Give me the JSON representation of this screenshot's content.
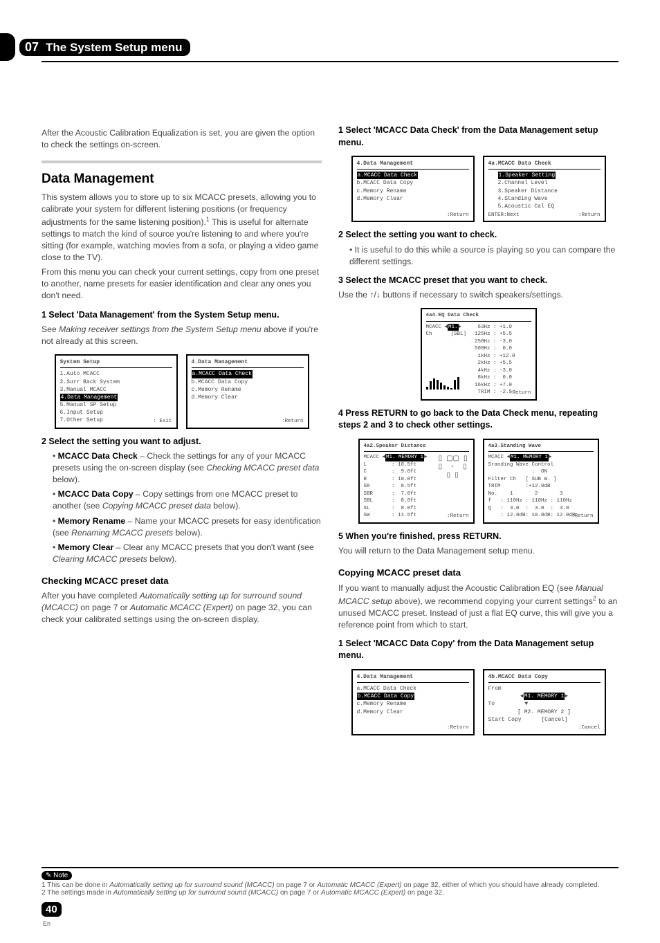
{
  "chapter": {
    "num": "07",
    "title": "The System Setup menu"
  },
  "col1": {
    "introA": "After the Acoustic Calibration Equalization is set, you are given the option to check the settings on-screen.",
    "section": "Data Management",
    "p1a": "This system allows you to store up to six MCACC presets, allowing you to calibrate your system for different listening positions (or frequency adjustments for the same listening position).",
    "p1sup": "1",
    "p1b": " This is useful for alternate settings to match the kind of source you're listening to and where you're sitting (for example, watching movies from a sofa, or playing a video game close to the TV).",
    "p2": "From this menu you can check your current settings, copy from one preset to another, name presets for easier identification and clear any ones you don't need.",
    "step1": "1   Select 'Data Management' from the System Setup menu.",
    "step1sub_a": "See ",
    "step1sub_i": "Making receiver settings from the System Setup menu",
    "step1sub_b": " above if you're not already at this screen.",
    "step2": "2   Select the setting you want to adjust.",
    "b1_label": "MCACC Data Check",
    "b1_text": " – Check the settings for any of your MCACC presets using the on-screen display (see ",
    "b1_i": "Checking MCACC preset data",
    "b1_end": " below).",
    "b2_label": "MCACC Data Copy",
    "b2_text": " – Copy settings from one MCACC preset to another (see ",
    "b2_i": "Copying MCACC preset data",
    "b2_end": " below).",
    "b3_label": "Memory Rename",
    "b3_text": " – Name your MCACC presets for easy identification (see ",
    "b3_i": "Renaming MCACC presets",
    "b3_end": " below).",
    "b4_label": "Memory Clear",
    "b4_text": " – Clear any MCACC presets that you don't want (see ",
    "b4_i": "Clearing MCACC presets",
    "b4_end": " below).",
    "subheadA": "Checking MCACC preset data",
    "subA_a": "After you have completed ",
    "subA_i1": "Automatically setting up for surround sound (MCACC)",
    "subA_b": " on page 7 or ",
    "subA_i2": "Automatic MCACC (Expert)",
    "subA_c": " on page 32, you can check your calibrated settings using the on-screen display."
  },
  "col2": {
    "step1": "1   Select 'MCACC Data Check' from the Data Management setup menu.",
    "step2": "2   Select the setting you want to check.",
    "step2bullet": "It is useful to do this while a source is playing so you can compare the different settings.",
    "step3": "3   Select the MCACC preset that you want to check.",
    "step3sub_a": "Use the ",
    "step3sub_b": " buttons if necessary to switch speakers/settings.",
    "step4": "4   Press RETURN to go back to the Data Check menu, repeating steps 2 and 3 to check other settings.",
    "step5": "5   When you're finished, press RETURN.",
    "step5sub": "You will return to the Data Management setup menu.",
    "subheadB": "Copying MCACC preset data",
    "copy_a": "If you want to manually adjust the Acoustic Calibration EQ (see ",
    "copy_i": "Manual MCACC setup",
    "copy_b": " above), we recommend copying your current settings",
    "copy_sup": "2",
    "copy_c": " to an unused MCACC preset. Instead of just a flat EQ curve, this will give you a reference point from which to start.",
    "copy_step1": "1   Select 'MCACC Data Copy' from the Data Management setup menu."
  },
  "osd": {
    "sys_title": "System Setup",
    "sys_l1": "1.Auto MCACC",
    "sys_l2": "2.Surr Back System",
    "sys_l3": "3.Manual MCACC",
    "sys_l4": "4.Data Management",
    "sys_l5": "5.Manual SP Setup",
    "sys_l6": "6.Input Setup",
    "sys_l7": "7.Other Setup",
    "sys_exit": ": Exit",
    "dm_title": "4.Data Management",
    "dm_a": "a.MCACC Data Check",
    "dm_b": "b.MCACC Data Copy",
    "dm_c": "c.Memory Rename",
    "dm_d": "d.Memory Clear",
    "return": ":Return",
    "dc_title": "4a.MCACC Data Check",
    "dc_1": "1.Speaker Setting",
    "dc_2": "2.Channel Level",
    "dc_3": "3.Speaker Distance",
    "dc_4": "4.Standing Wave",
    "dc_5": "5.Acoustic Cal EQ",
    "enter_next": "ENTER:Next",
    "eq_title": "4a4.EQ Data Check",
    "eq_mcacc": "MCACC ",
    "eq_m1": "M1.",
    "eq_ch": "Ch      [SBL]",
    "eq_63": "  63Hz : +1.0",
    "eq_125": " 125Hz : +5.5",
    "eq_250": " 250Hz : -3.0",
    "eq_500": " 500Hz :  0.0",
    "eq_1k": "  1kHz : +12.0",
    "eq_2k": "  2kHz : +5.5",
    "eq_4k": "  4kHz : -3.0",
    "eq_8k": "  8kHz :  0.0",
    "eq_16k": " 16kHz : +7.0",
    "eq_trim": "  TRIM : -2.5",
    "sd_title": "4a2.Speaker Distance",
    "sd_mem": "M1. MEMORY 1",
    "sd_L": "L        : 10.5ft",
    "sd_C": "C        :  9.0ft",
    "sd_R": "R        : 10.0ft",
    "sd_SR": "SR       :  8.5ft",
    "sd_SBR": "SBR      :  7.0ft",
    "sd_SBL": "SBL      :  8.0ft",
    "sd_SL": "SL       :  8.0ft",
    "sd_SW": "SW       : 11.5ft",
    "sw_title": "4a3.Standing Wave",
    "sw_ctrl": "Sranding Wave Control",
    "sw_on": "              :  ON",
    "sw_fil": "Filter Ch   [ SUB W. ]",
    "sw_trim": "TRIM        :+12.0dB",
    "sw_no": "No.    1       2       3",
    "sw_f": "f   : 110Hz : 110Hz : 110Hz",
    "sw_q": "Q   :  3.0  :  3.0  :  3.0",
    "sw_a": "    : 12.0dB: 10.0dB: 12.0dB",
    "cp_title": "4b.MCACC Data Copy",
    "cp_from": "From",
    "cp_m1": "M1. MEMORY 1",
    "cp_to": "To",
    "cp_m2": "[ M2. MEMORY 2 ]",
    "cp_start": "Start Copy",
    "cp_cancel": "[Cancel]",
    "cancel": ":Cancel"
  },
  "notes": {
    "label": "Note",
    "n1a": "1 This can be done in ",
    "n1i1": "Automatically setting up for surround sound (MCACC)",
    "n1b": " on page 7 or ",
    "n1i2": "Automatic MCACC (Expert)",
    "n1c": " on page 32, either of which you should have already completed.",
    "n2a": "2 The settings made in ",
    "n2i1": "Automatically setting up for surround sound (MCACC)",
    "n2b": " on page 7 or ",
    "n2i2": "Automatic MCACC (Expert)",
    "n2c": " on page 32."
  },
  "page": {
    "num": "40",
    "lang": "En"
  }
}
